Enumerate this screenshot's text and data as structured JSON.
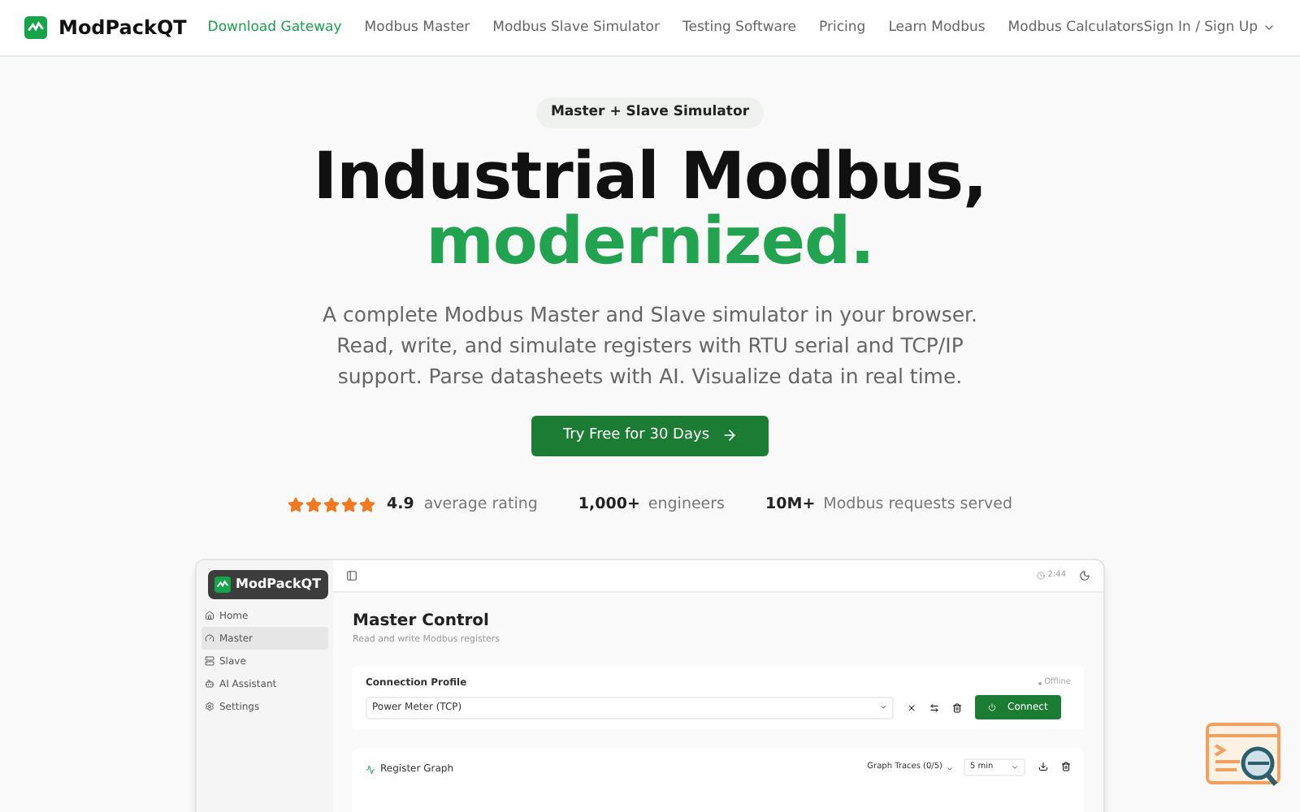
{
  "brand": "ModPackQT",
  "nav": [
    {
      "label": "Download Gateway",
      "selected": true
    },
    {
      "label": "Modbus Master",
      "selected": false
    },
    {
      "label": "Modbus Slave Simulator",
      "selected": false
    },
    {
      "label": "Testing Software",
      "selected": false
    },
    {
      "label": "Pricing",
      "selected": false
    },
    {
      "label": "Learn Modbus",
      "selected": false
    },
    {
      "label": "Modbus Calculators",
      "selected": false
    }
  ],
  "sign_in": "Sign In / Sign Up",
  "hero": {
    "badge": "Master + Slave Simulator",
    "title_line1": "Industrial Modbus,",
    "title_line2": "modernized.",
    "description": "A complete Modbus Master and Slave simulator in your browser. Read, write, and simulate registers with RTU serial and TCP/IP support. Parse datasheets with AI. Visualize data in real time.",
    "cta": "Try Free for 30 Days"
  },
  "stats": {
    "stars": 5,
    "rating": "4.9",
    "rating_label": "average rating",
    "engineers": "1,000+",
    "engineers_label": "engineers",
    "requests": "10M+",
    "requests_label": "Modbus requests served"
  },
  "app": {
    "brand": "ModPackQT",
    "sidebar": [
      {
        "label": "Home",
        "selected": false
      },
      {
        "label": "Master",
        "selected": true
      },
      {
        "label": "Slave",
        "selected": false
      },
      {
        "label": "AI Assistant",
        "selected": false
      },
      {
        "label": "Settings",
        "selected": false
      }
    ],
    "time": "2:44",
    "title": "Master Control",
    "subtitle": "Read and write Modbus registers",
    "connection": {
      "label": "Connection Profile",
      "status": "Offline",
      "profile": "Power Meter (TCP)",
      "connect": "Connect"
    },
    "graph": {
      "label": "Register Graph",
      "traces": "Graph Traces (0/5)",
      "range": "5 min"
    }
  }
}
